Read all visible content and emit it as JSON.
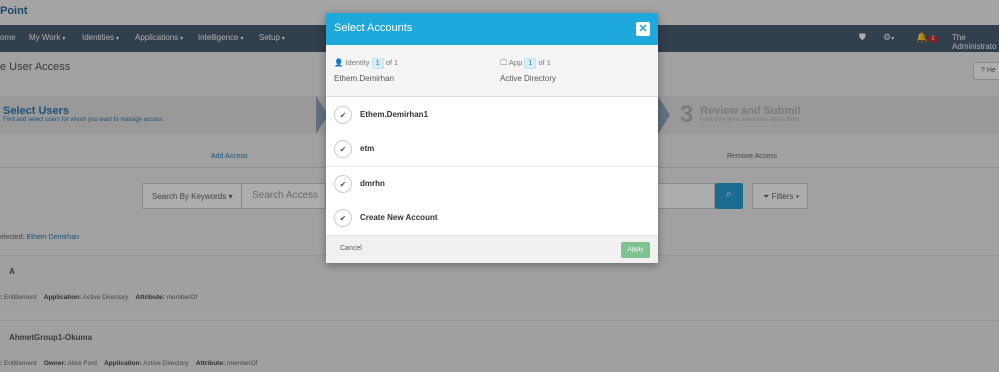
{
  "app": {
    "logo_text": "Point"
  },
  "navbar": {
    "items": [
      {
        "label": "ome"
      },
      {
        "label": "My Work"
      },
      {
        "label": "Identities"
      },
      {
        "label": "Applications"
      },
      {
        "label": "Intelligence"
      },
      {
        "label": "Setup"
      }
    ],
    "notification_count": "2",
    "user_label": "The Administrato"
  },
  "page": {
    "title": "e User Access",
    "help_label": "He"
  },
  "wizard": {
    "step1_title": "Select Users",
    "step1_subtitle": "Find and select users for whom you want to manage access.",
    "step3_number": "3",
    "step3_title": "Review and Submit",
    "step3_subtitle": "Look over your selections and submit"
  },
  "tabs": {
    "add": "Add Access",
    "remove": "Remove Access"
  },
  "search": {
    "dropdown_label": "Search By Keywords",
    "placeholder": "Search Access",
    "filters_label": "Filters"
  },
  "selection": {
    "prefix": "elected: ",
    "value": "Ethem Demirhan"
  },
  "rows": [
    {
      "title": "A",
      "meta": [
        {
          "key": ":",
          "value": "Entitlement"
        },
        {
          "key": "Application:",
          "value": "Active Directory"
        },
        {
          "key": "Attribute:",
          "value": "memberOf"
        }
      ]
    },
    {
      "title": "AhmetGroup1-Okuma",
      "meta": [
        {
          "key": ":",
          "value": "Entitlement"
        },
        {
          "key": "Owner:",
          "value": "Alice Ford"
        },
        {
          "key": "Application:",
          "value": "Active Directory"
        },
        {
          "key": "Attribute:",
          "value": "memberOf"
        }
      ]
    }
  ],
  "modal": {
    "title": "Select Accounts",
    "identity": {
      "label": "Identity",
      "current": "1",
      "of_text": "of 1",
      "value": "Ethem.Demirhan"
    },
    "app": {
      "label": "App",
      "current": "1",
      "of_text": "of 1",
      "value": "Active Directory"
    },
    "accounts": [
      {
        "name": "Ethem.Demirhan1"
      },
      {
        "name": "etm"
      },
      {
        "name": "dmrhn"
      },
      {
        "name": "Create New Account"
      }
    ],
    "cancel_label": "Cancel",
    "apply_label": "Apply"
  }
}
